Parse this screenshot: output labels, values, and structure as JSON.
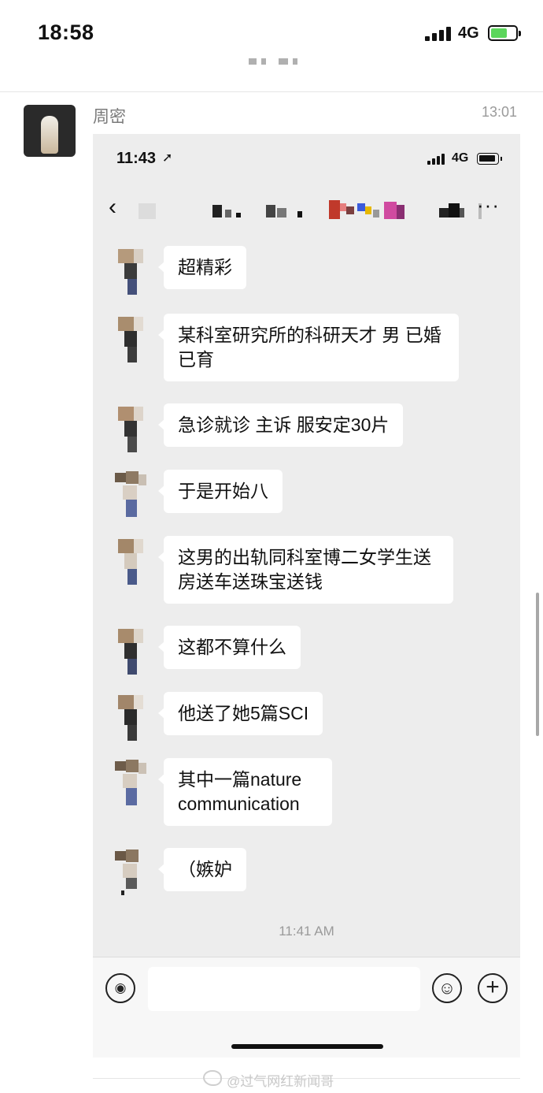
{
  "status_bar": {
    "time": "18:58",
    "network": "4G"
  },
  "post": {
    "author": "周密",
    "time": "13:01"
  },
  "screenshot": {
    "status_bar": {
      "time": "11:43",
      "location_glyph": "➚",
      "network": "4G"
    },
    "nav": {
      "back_glyph": "‹",
      "more_glyph": "···"
    },
    "messages": [
      {
        "text": "超精彩"
      },
      {
        "text": "某科室研究所的科研天才 男 已婚已育"
      },
      {
        "text": "急诊就诊 主诉 服安定30片"
      },
      {
        "text": "于是开始八"
      },
      {
        "text": "这男的出轨同科室博二女学生送房送车送珠宝送钱"
      },
      {
        "text": "这都不算什么"
      },
      {
        "text": "他送了她5篇SCI"
      },
      {
        "text": "其中一篇nature communication"
      },
      {
        "text": "（嫉妒"
      }
    ],
    "chat_timestamp": "11:41 AM",
    "input_bar": {
      "voice_glyph": "◉",
      "emoji_glyph": "☺",
      "plus_glyph": "+"
    }
  },
  "watermark": "@过气网红新闻哥"
}
